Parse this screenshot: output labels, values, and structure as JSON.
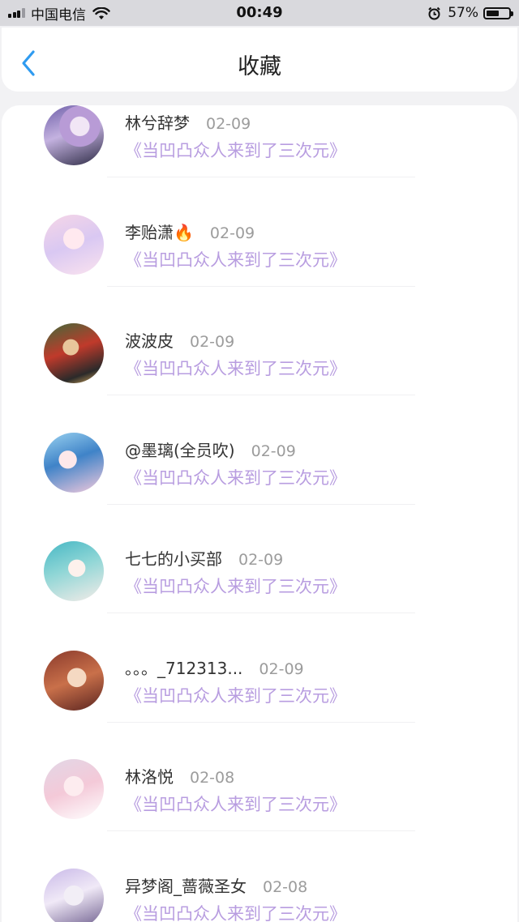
{
  "status_bar": {
    "carrier": "中国电信",
    "time": "00:49",
    "battery_percent": "57%",
    "battery_level": 0.57,
    "icons": [
      "signal-icon",
      "wifi-icon",
      "alarm-icon",
      "battery-icon"
    ]
  },
  "nav": {
    "title": "收藏",
    "back_icon": "chevron-left-icon",
    "accent_color": "#2f9bf0"
  },
  "list": {
    "link_color": "#b89de0",
    "items": [
      {
        "name": "林兮辞梦",
        "date": "02-09",
        "work": "《当凹凸众人来到了三次元》"
      },
      {
        "name": "李贻潇🔥",
        "date": "02-09",
        "work": "《当凹凸众人来到了三次元》"
      },
      {
        "name": "波波皮",
        "date": "02-09",
        "work": "《当凹凸众人来到了三次元》"
      },
      {
        "name": "@墨璃(全员吹)",
        "date": "02-09",
        "work": "《当凹凸众人来到了三次元》"
      },
      {
        "name": "七七的小买部",
        "date": "02-09",
        "work": "《当凹凸众人来到了三次元》"
      },
      {
        "name": "。。。_712313...",
        "date": "02-09",
        "work": "《当凹凸众人来到了三次元》"
      },
      {
        "name": "林洛悦",
        "date": "02-08",
        "work": "《当凹凸众人来到了三次元》"
      },
      {
        "name": "异梦阁_蔷薇圣女",
        "date": "02-08",
        "work": "《当凹凸众人来到了三次元》"
      }
    ]
  }
}
